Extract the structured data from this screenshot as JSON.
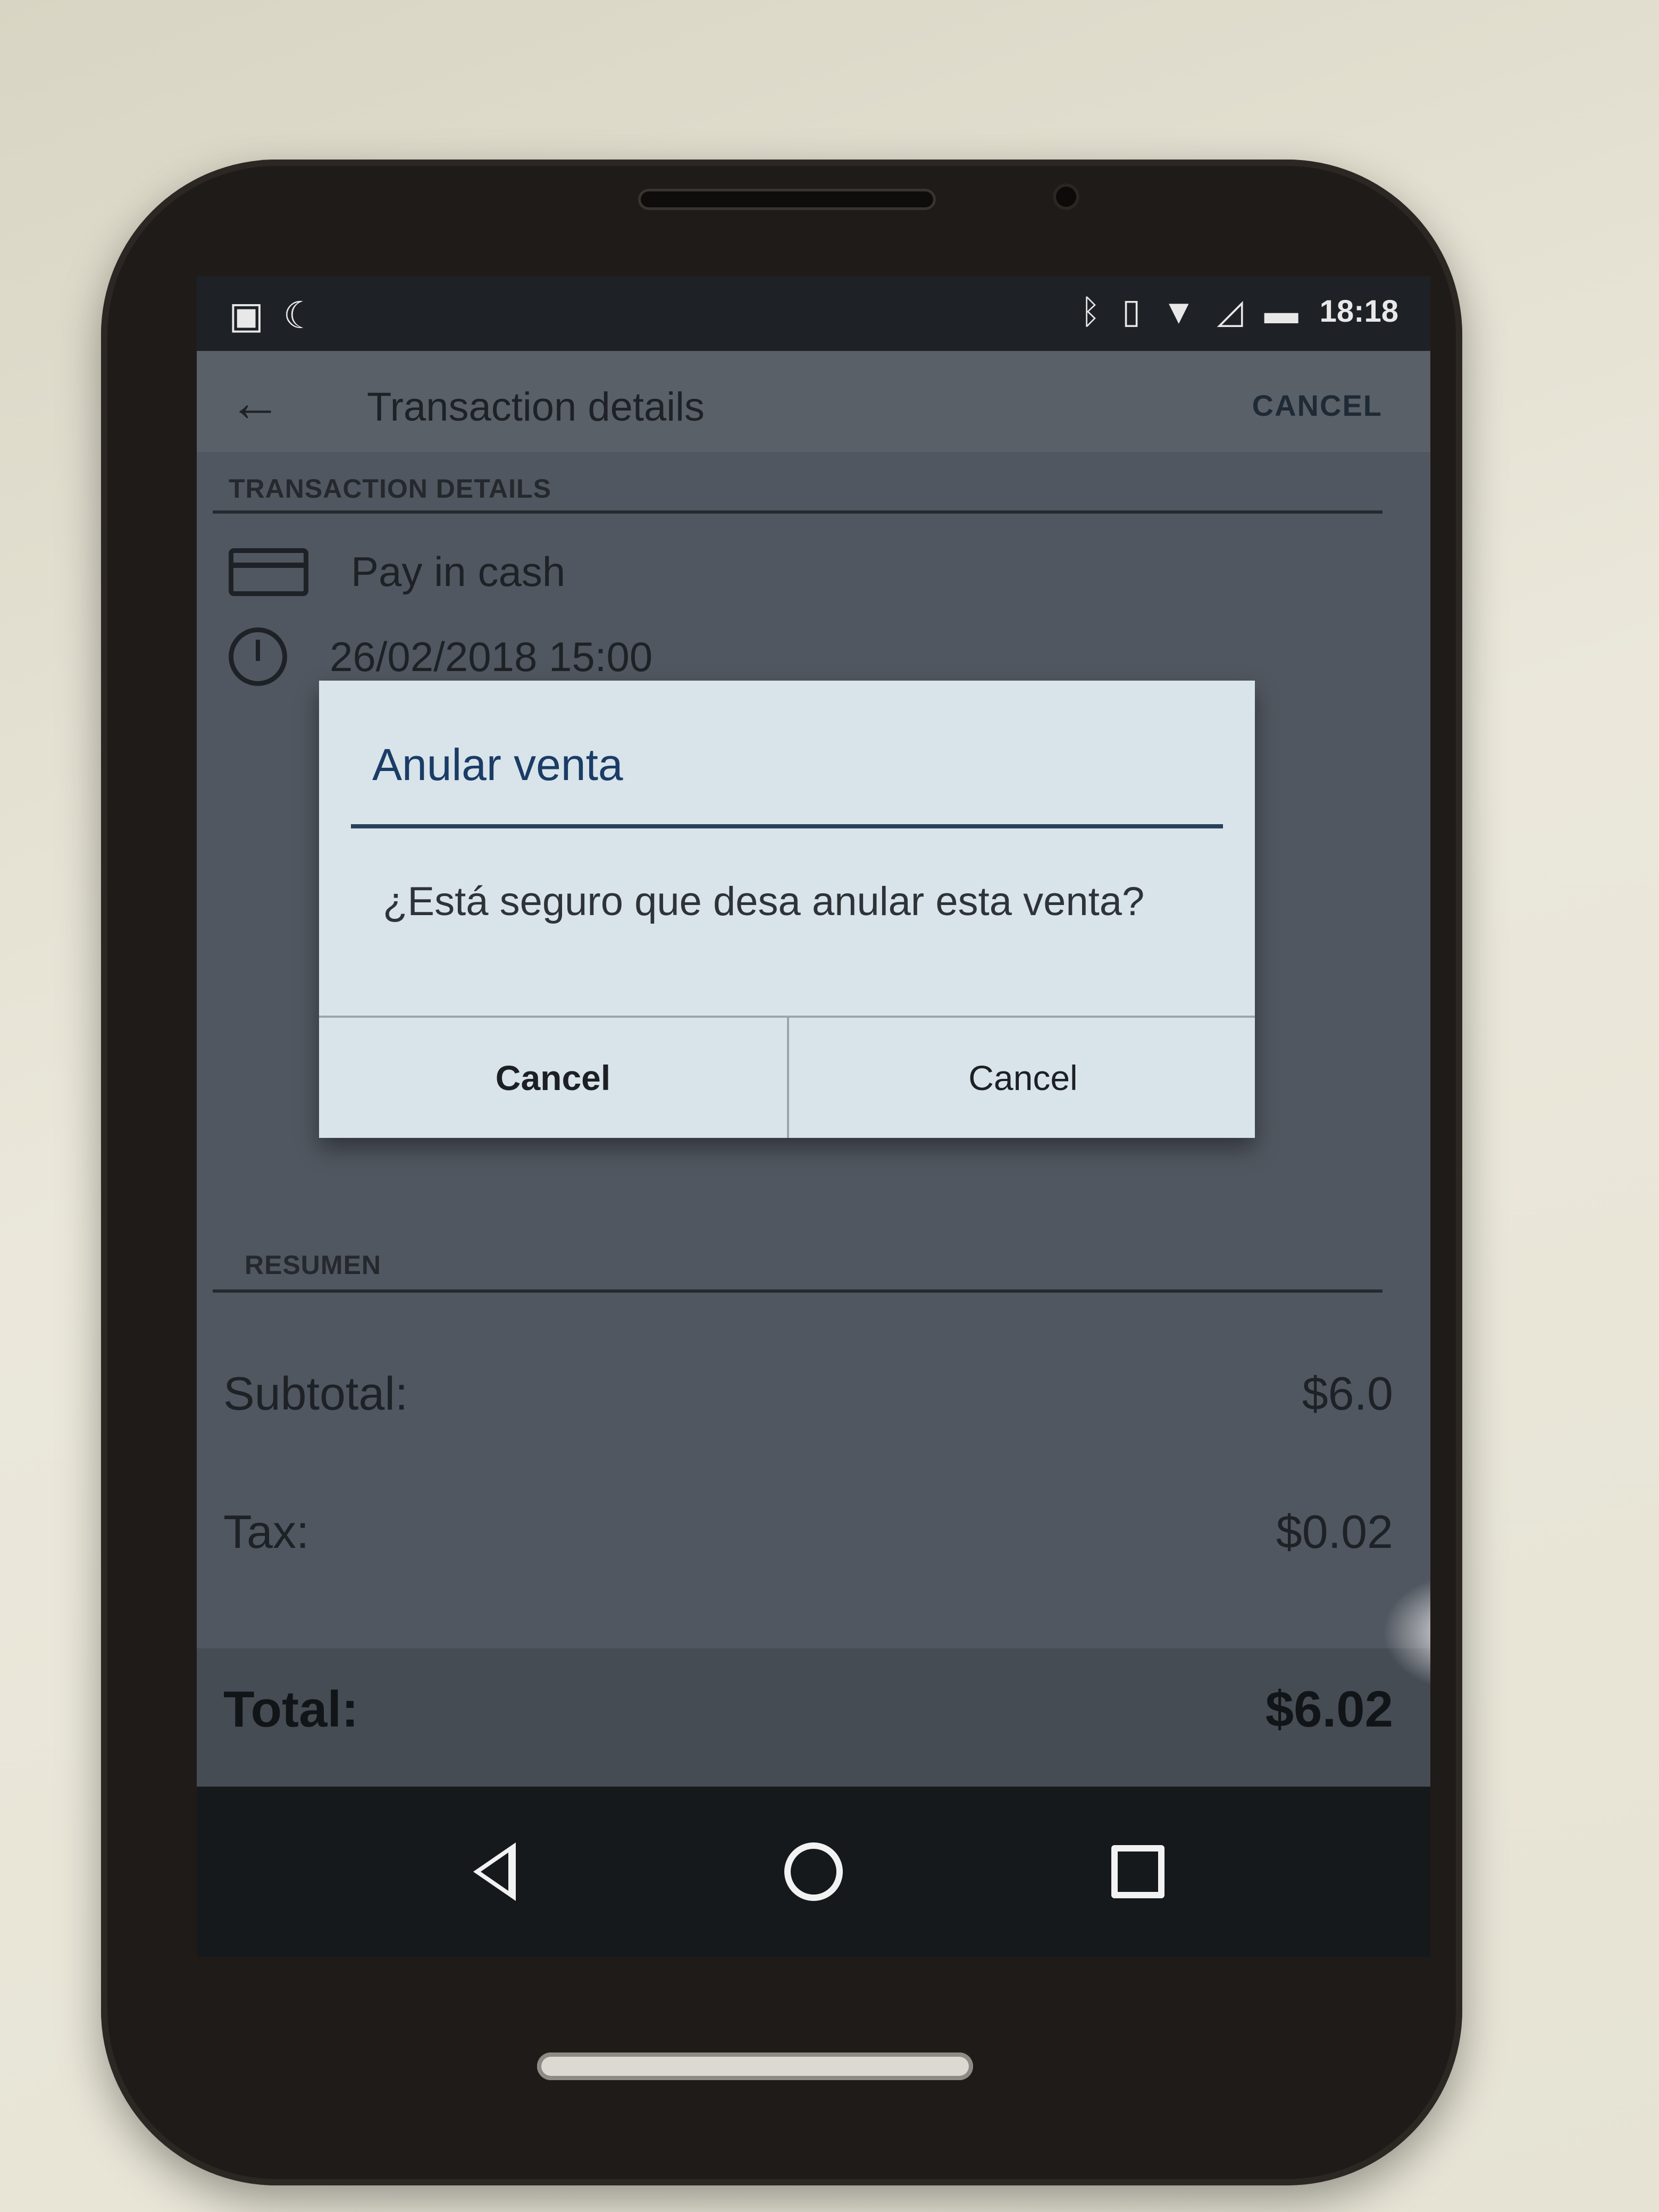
{
  "status_bar": {
    "left_icons": [
      "image-icon",
      "notification-icon"
    ],
    "right_icons": [
      "bluetooth-icon",
      "vibrate-icon",
      "wifi-icon",
      "signal-icon",
      "battery-icon"
    ],
    "time": "18:18"
  },
  "appbar": {
    "back_icon": "back-arrow-icon",
    "title": "Transaction details",
    "action": "CANCEL"
  },
  "details": {
    "section_header": "TRANSACTION DETAILS",
    "payment_method": "Pay in cash",
    "datetime": "26/02/2018 15:00"
  },
  "dialog": {
    "title": "Anular venta",
    "message": "¿Está seguro que desa anular esta venta?",
    "button_left": "Cancel",
    "button_right": "Cancel"
  },
  "summary": {
    "section_header": "RESUMEN",
    "subtotal_label": "Subtotal:",
    "subtotal_value": "$6.0",
    "tax_label": "Tax:",
    "tax_value": "$0.02",
    "total_label": "Total:",
    "total_value": "$6.02"
  },
  "navbar": {
    "icons": [
      "back-triangle-icon",
      "home-circle-icon",
      "recents-square-icon"
    ]
  }
}
